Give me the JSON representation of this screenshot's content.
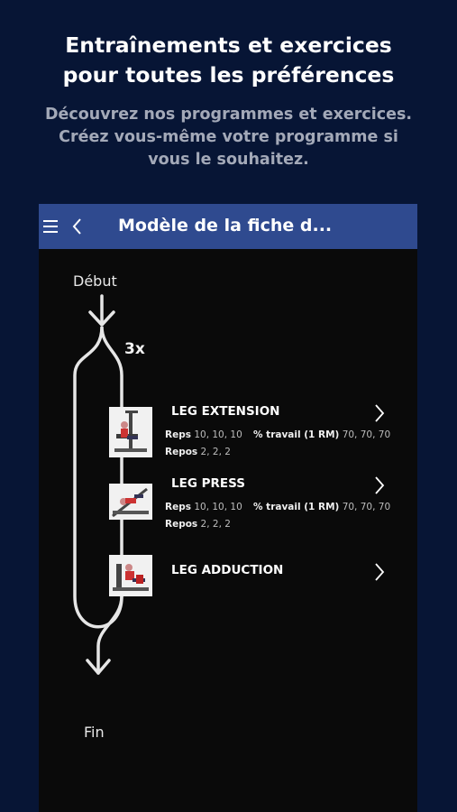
{
  "promo": {
    "title": "Entraînements et exercices\npour toutes les préférences",
    "subtitle": "Découvrez nos programmes et exercices.\nCréez vous-même votre programme si\nvous le souhaitez."
  },
  "app_bar": {
    "title": "Modèle de la fiche d...",
    "bg_color": "#2f4a8f"
  },
  "flow": {
    "start_label": "Début",
    "end_label": "Fin",
    "rounds_label": "3x"
  },
  "exercises": [
    {
      "name": "LEG EXTENSION",
      "reps_label": "Reps",
      "reps_value": "10, 10, 10",
      "work_label": "% travail (1 RM)",
      "work_value": "70, 70, 70",
      "rest_label": "Repos",
      "rest_value": "2, 2, 2"
    },
    {
      "name": "LEG PRESS",
      "reps_label": "Reps",
      "reps_value": "10, 10, 10",
      "work_label": "% travail (1 RM)",
      "work_value": "70, 70, 70",
      "rest_label": "Repos",
      "rest_value": "2, 2, 2"
    },
    {
      "name": "LEG ADDUCTION"
    }
  ],
  "icons": {
    "menu": "menu-icon",
    "back": "chevron-left-icon",
    "chevron": "chevron-right-icon"
  }
}
